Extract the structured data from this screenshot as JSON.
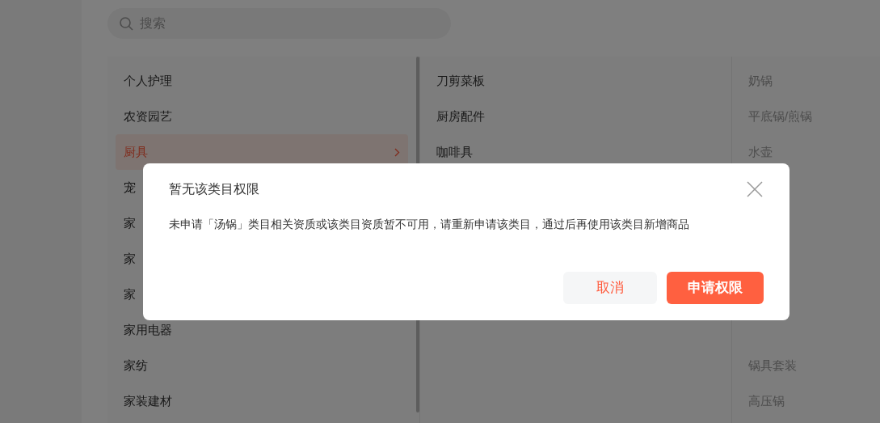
{
  "search": {
    "placeholder": "搜索"
  },
  "categories": {
    "column_1": [
      {
        "label": "个人护理",
        "selected": false
      },
      {
        "label": "农资园艺",
        "selected": false
      },
      {
        "label": "厨具",
        "selected": true
      },
      {
        "label": "宠",
        "selected": false
      },
      {
        "label": "家",
        "selected": false
      },
      {
        "label": "家",
        "selected": false
      },
      {
        "label": "家",
        "selected": false
      },
      {
        "label": "家用电器",
        "selected": false
      },
      {
        "label": "家纺",
        "selected": false
      },
      {
        "label": "家装建材",
        "selected": false
      }
    ],
    "column_2": [
      {
        "label": "刀剪菜板"
      },
      {
        "label": "厨房配件"
      },
      {
        "label": "咖啡具"
      }
    ],
    "column_3": [
      {
        "label": "奶锅"
      },
      {
        "label": "平底锅/煎锅"
      },
      {
        "label": "水壶"
      }
    ],
    "column_3_below_dialog": [
      {
        "label": "锅具套装"
      },
      {
        "label": "高压锅"
      }
    ]
  },
  "dialog": {
    "title": "暂无该类目权限",
    "message": "未申请「汤锅」类目相关资质或该类目资质暂不可用，请重新申请该类目，通过后再使用该类目新增商品",
    "buttons": [
      {
        "label": "取消",
        "kind": "secondary"
      },
      {
        "label": "申请权限",
        "kind": "primary"
      }
    ]
  }
}
